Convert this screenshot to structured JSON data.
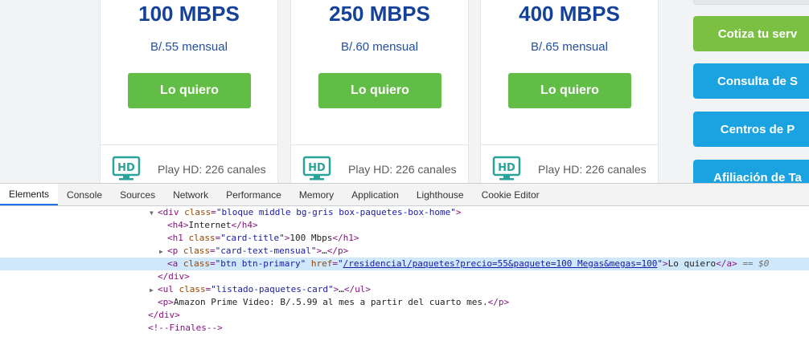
{
  "cards": [
    {
      "speed": "100 MBPS",
      "price": "B/.55 mensual",
      "button": "Lo quiero",
      "feature": "Play HD: 226 canales",
      "hd_label": "HD"
    },
    {
      "speed": "250 MBPS",
      "price": "B/.60 mensual",
      "button": "Lo quiero",
      "feature": "Play HD: 226 canales",
      "hd_label": "HD"
    },
    {
      "speed": "400 MBPS",
      "price": "B/.65 mensual",
      "button": "Lo quiero",
      "feature": "Play HD: 226 canales",
      "hd_label": "HD"
    }
  ],
  "sidebar": {
    "cotiza": "Cotiza tu serv",
    "consulta": "Consulta de S",
    "centros": "Centros de P",
    "afiliacion": "Afiliación de Ta"
  },
  "colors": {
    "brand_blue": "#14419a",
    "button_green": "#62bd46",
    "side_green": "#7bc043",
    "side_blue": "#1aa3e0"
  },
  "devtools": {
    "tabs": [
      "Elements",
      "Console",
      "Sources",
      "Network",
      "Performance",
      "Memory",
      "Application",
      "Lighthouse",
      "Cookie Editor"
    ],
    "active_tab": "Elements",
    "dom": {
      "l1_tag": "div",
      "l1_attr": "class",
      "l1_val": "bloque middle bg-gris box-paquetes-box-home",
      "l2_tag": "h4",
      "l2_text": "Internet",
      "l3_tag": "h1",
      "l3_attr": "class",
      "l3_val": "card-title",
      "l3_text": "100 Mbps",
      "l4_tag": "p",
      "l4_attr": "class",
      "l4_val": "card-text-mensual",
      "l4_text": "…",
      "l5_tag": "a",
      "l5_attr1": "class",
      "l5_val1": "btn btn-primary",
      "l5_attr2": "href",
      "l5_href": "/residencial/paquetes?precio=55&paquete=100 Megas&megas=100",
      "l5_text": "Lo quiero",
      "l5_eq": "== $0",
      "l6_tag": "div",
      "l7_tag": "ul",
      "l7_attr": "class",
      "l7_val": "listado-paquetes-card",
      "l7_text": "…",
      "l8_tag": "p",
      "l8_text": "Amazon Prime Video: B/.5.99 al mes a partir del cuarto mes.",
      "l9_tag": "div",
      "l10_text": "<!--Finales-->"
    }
  }
}
